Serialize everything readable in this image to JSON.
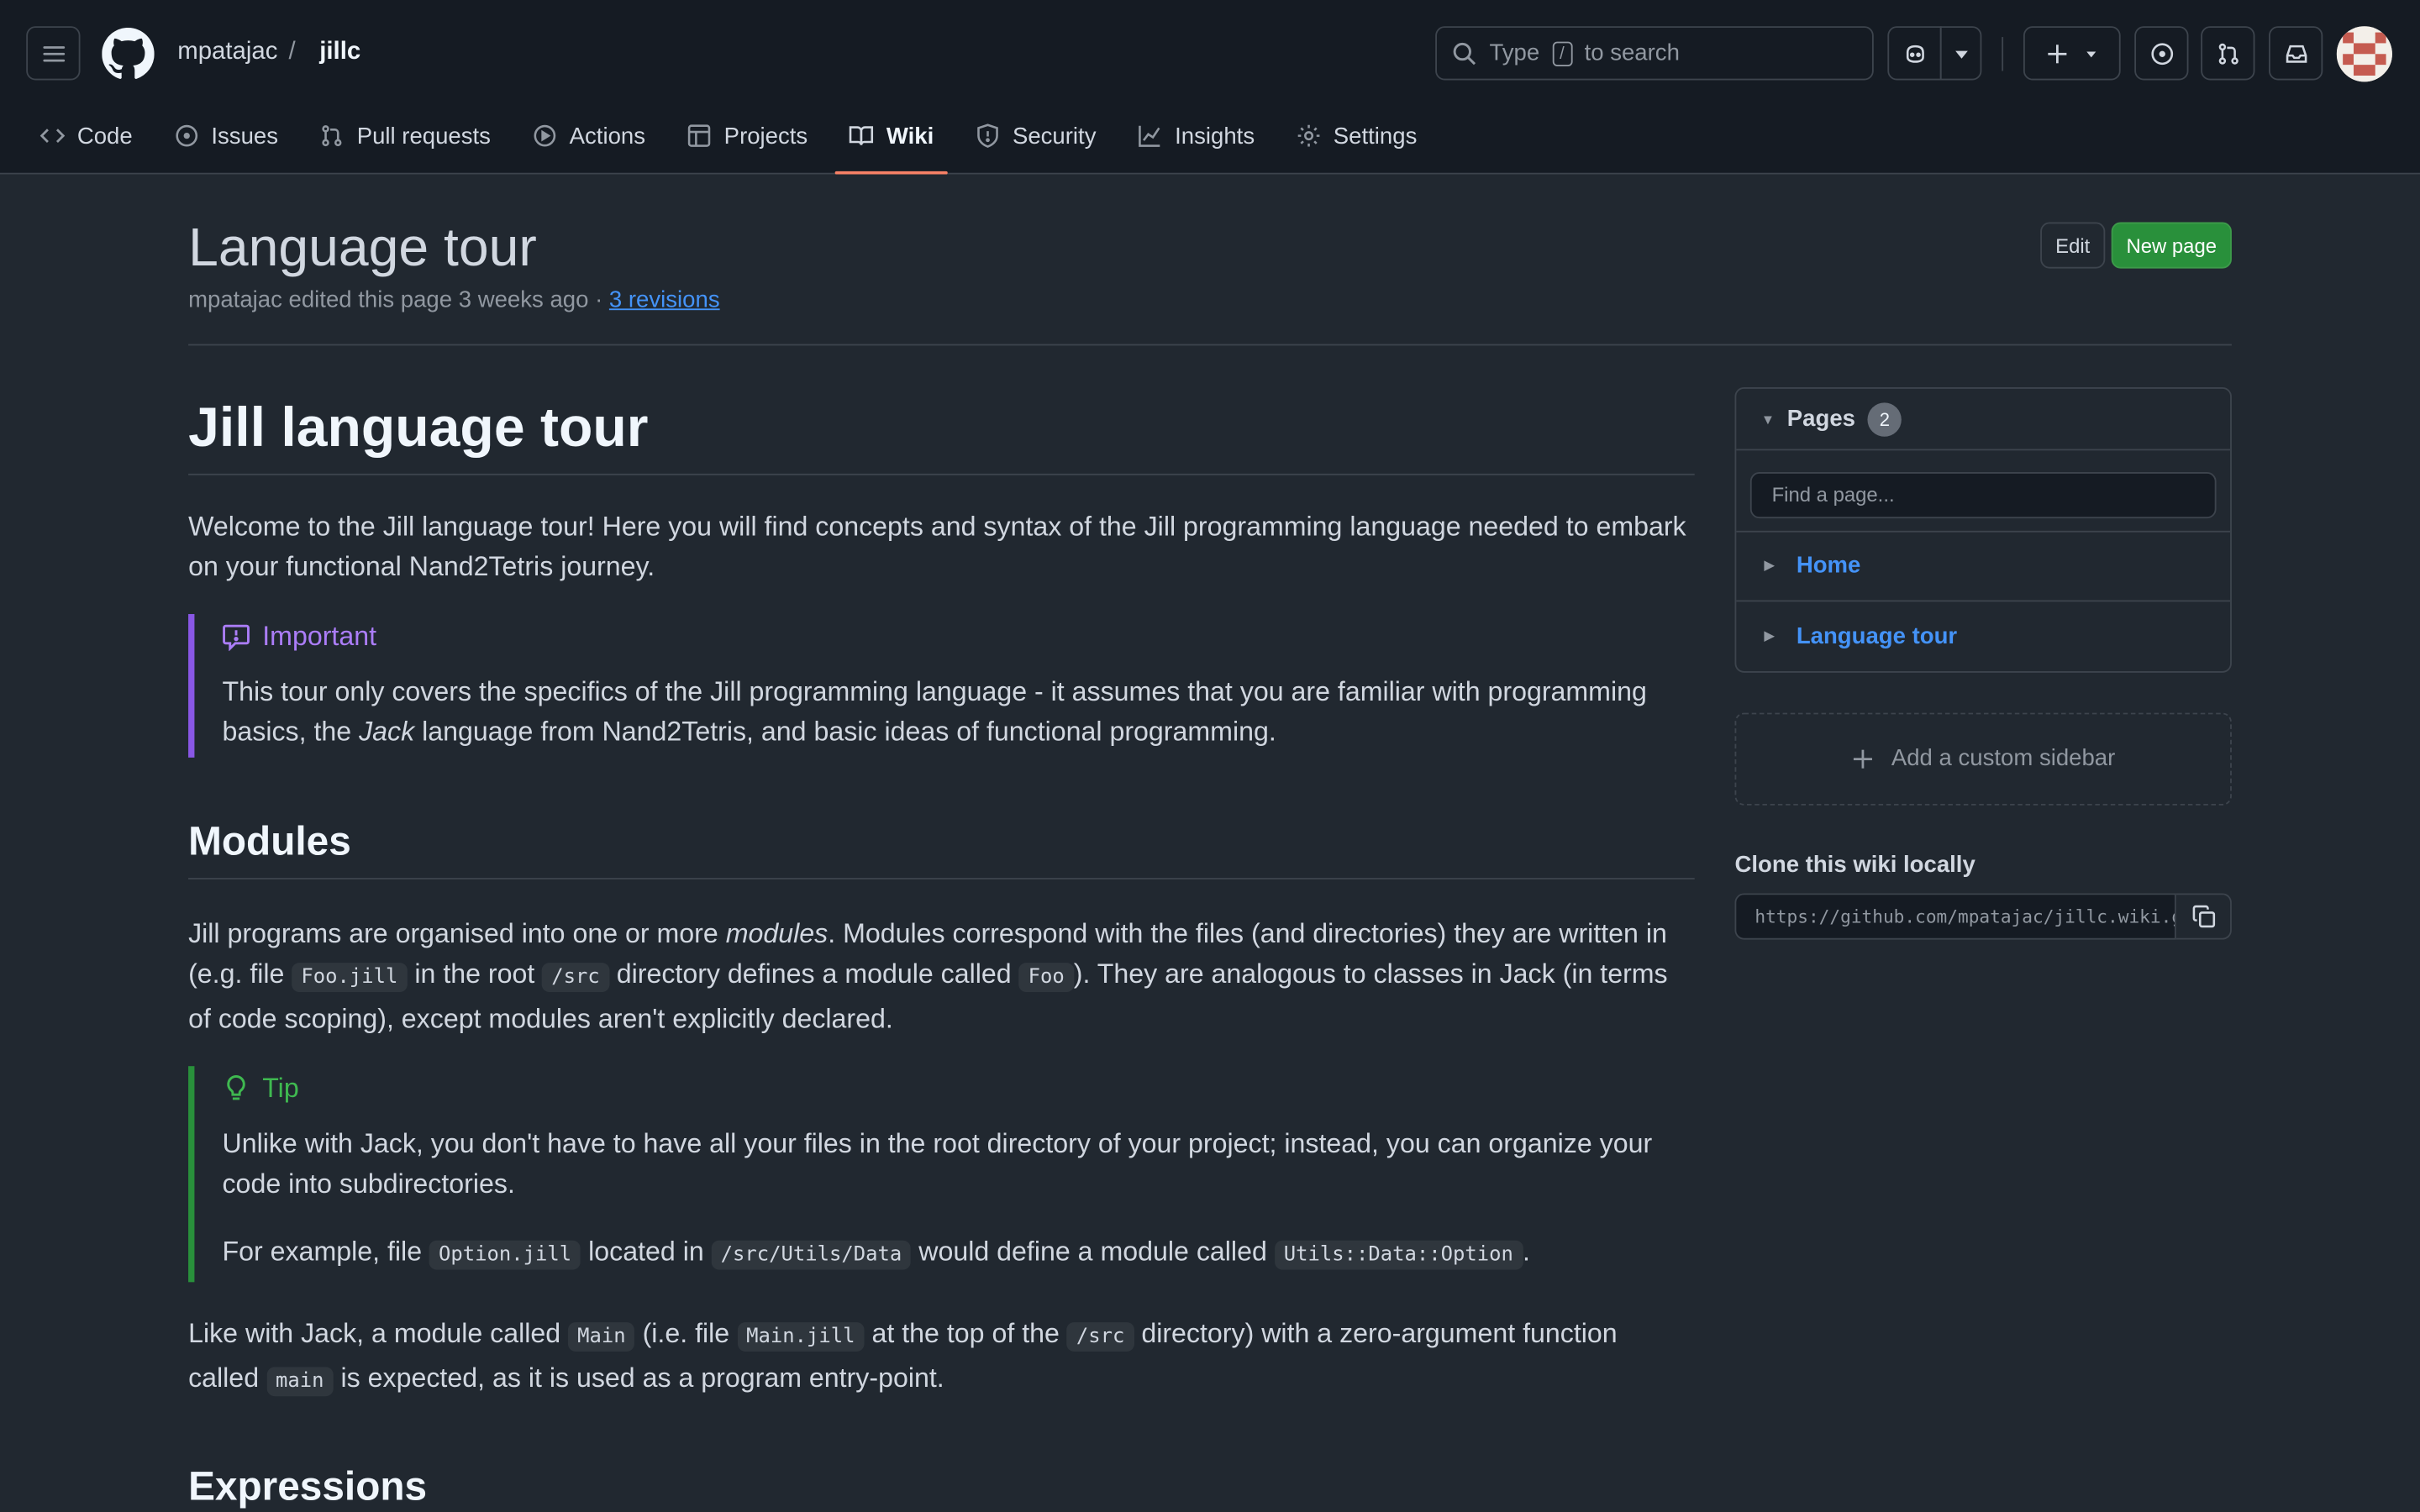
{
  "header": {
    "owner": "mpatajac",
    "separator": "/",
    "repo": "jillc",
    "search_prefix": "Type",
    "search_key": "/",
    "search_suffix": "to search"
  },
  "tabs": [
    {
      "label": "Code",
      "icon": "code-icon"
    },
    {
      "label": "Issues",
      "icon": "issue-icon"
    },
    {
      "label": "Pull requests",
      "icon": "pull-request-icon"
    },
    {
      "label": "Actions",
      "icon": "play-icon"
    },
    {
      "label": "Projects",
      "icon": "table-icon"
    },
    {
      "label": "Wiki",
      "icon": "book-icon",
      "active": true
    },
    {
      "label": "Security",
      "icon": "shield-icon"
    },
    {
      "label": "Insights",
      "icon": "graph-icon"
    },
    {
      "label": "Settings",
      "icon": "gear-icon"
    }
  ],
  "page": {
    "title": "Language tour",
    "meta": "mpatajac edited this page 3 weeks ago · ",
    "revisions": "3 revisions",
    "edit_label": "Edit",
    "new_page_label": "New page"
  },
  "article": {
    "h1": "Jill language tour",
    "intro": "Welcome to the Jill language tour! Here you will find concepts and syntax of the Jill programming language needed to embark on your functional Nand2Tetris journey.",
    "important_title": "Important",
    "important_a": "This tour only covers the specifics of the Jill programming language - it assumes that you are familiar with programming basics, the ",
    "important_em": "Jack",
    "important_b": " language from Nand2Tetris, and basic ideas of functional programming.",
    "modules_heading": "Modules",
    "modules_a": "Jill programs are organised into one or more ",
    "modules_em": "modules",
    "modules_b": ". Modules correspond with the files (and directories) they are written in (e.g. file ",
    "modules_code1": "Foo.jill",
    "modules_c": " in the root ",
    "modules_code2": "/src",
    "modules_d": " directory defines a module called ",
    "modules_code3": "Foo",
    "modules_e": "). They are analogous to classes in Jack (in terms of code scoping), except modules aren't explicitly declared.",
    "tip_title": "Tip",
    "tip_p1": "Unlike with Jack, you don't have to have all your files in the root directory of your project; instead, you can organize your code into subdirectories.",
    "tip_a": "For example, file ",
    "tip_code1": "Option.jill",
    "tip_b": " located in ",
    "tip_code2": "/src/Utils/Data",
    "tip_c": " would define a module called ",
    "tip_code3": "Utils::Data::Option",
    "tip_d": ".",
    "main_a": "Like with Jack, a module called ",
    "main_code1": "Main",
    "main_b": " (i.e. file ",
    "main_code2": "Main.jill",
    "main_c": " at the top of the ",
    "main_code3": "/src",
    "main_d": " directory) with a zero-argument function called ",
    "main_code4": "main",
    "main_e": " is expected, as it is used as a program entry-point.",
    "expressions_heading": "Expressions"
  },
  "sidebar": {
    "pages_label": "Pages",
    "pages_count": "2",
    "find_placeholder": "Find a page...",
    "pages": [
      "Home",
      "Language tour"
    ],
    "custom_sidebar": "Add a custom sidebar",
    "clone_title": "Clone this wiki locally",
    "clone_url": "https://github.com/mpatajac/jillc.wiki.git"
  },
  "colors": {
    "background": "#212830",
    "header": "#151b23",
    "accent_link": "#4493f8",
    "active_tab": "#f78166",
    "new_page_button": "#29903b",
    "important": "#ab7df8",
    "tip": "#3fb950"
  }
}
